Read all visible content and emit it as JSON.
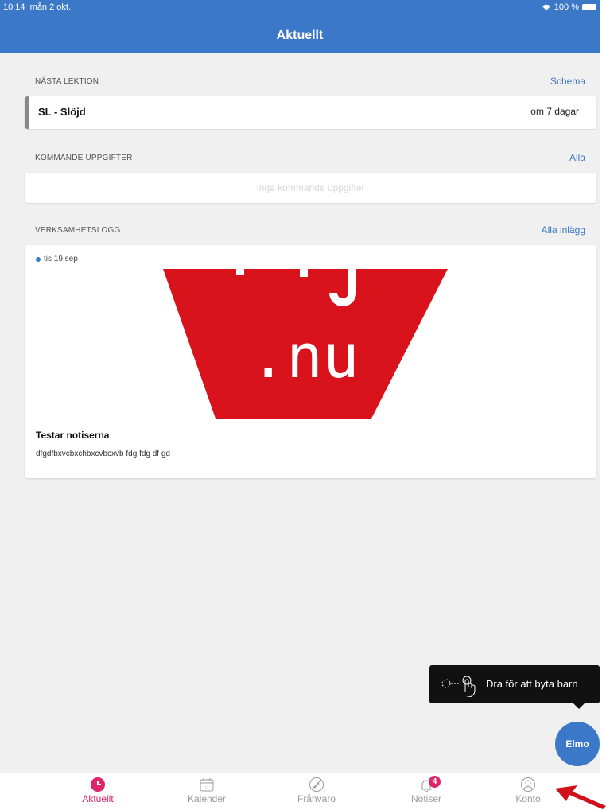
{
  "status": {
    "time": "10:14",
    "date": "mån 2 okt.",
    "battery": "100 %"
  },
  "header": {
    "title": "Aktuellt"
  },
  "next_lesson": {
    "heading": "NÄSTA LEKTION",
    "link": "Schema",
    "name": "SL - Slöjd",
    "when": "om 7 dagar"
  },
  "assignments": {
    "heading": "KOMMANDE UPPGIFTER",
    "link": "Alla",
    "empty": "Inga kommande uppgifter"
  },
  "activity_log": {
    "heading": "VERKSAMHETSLOGG",
    "link": "Alla inlägg",
    "post": {
      "date": "tis 19 sep",
      "title": "Testar notiserna",
      "body": "dfgdfbxvcbxchbxcvbcxvb fdg fdg df gd",
      "image_text": ".nu"
    }
  },
  "tooltip": {
    "text": "Dra för att byta barn"
  },
  "fab": {
    "label": "Elmo"
  },
  "tabs": [
    {
      "label": "Aktuellt",
      "icon": "clock-icon",
      "active": true
    },
    {
      "label": "Kalender",
      "icon": "calendar-icon",
      "active": false
    },
    {
      "label": "Frånvaro",
      "icon": "absence-icon",
      "active": false
    },
    {
      "label": "Notiser",
      "icon": "bell-icon",
      "active": false,
      "badge": "4"
    },
    {
      "label": "Konto",
      "icon": "user-icon",
      "active": false
    }
  ],
  "colors": {
    "primary": "#3b78c8",
    "accent": "#e0246a",
    "arrow": "#d0101a",
    "logo_red": "#d9131c"
  }
}
